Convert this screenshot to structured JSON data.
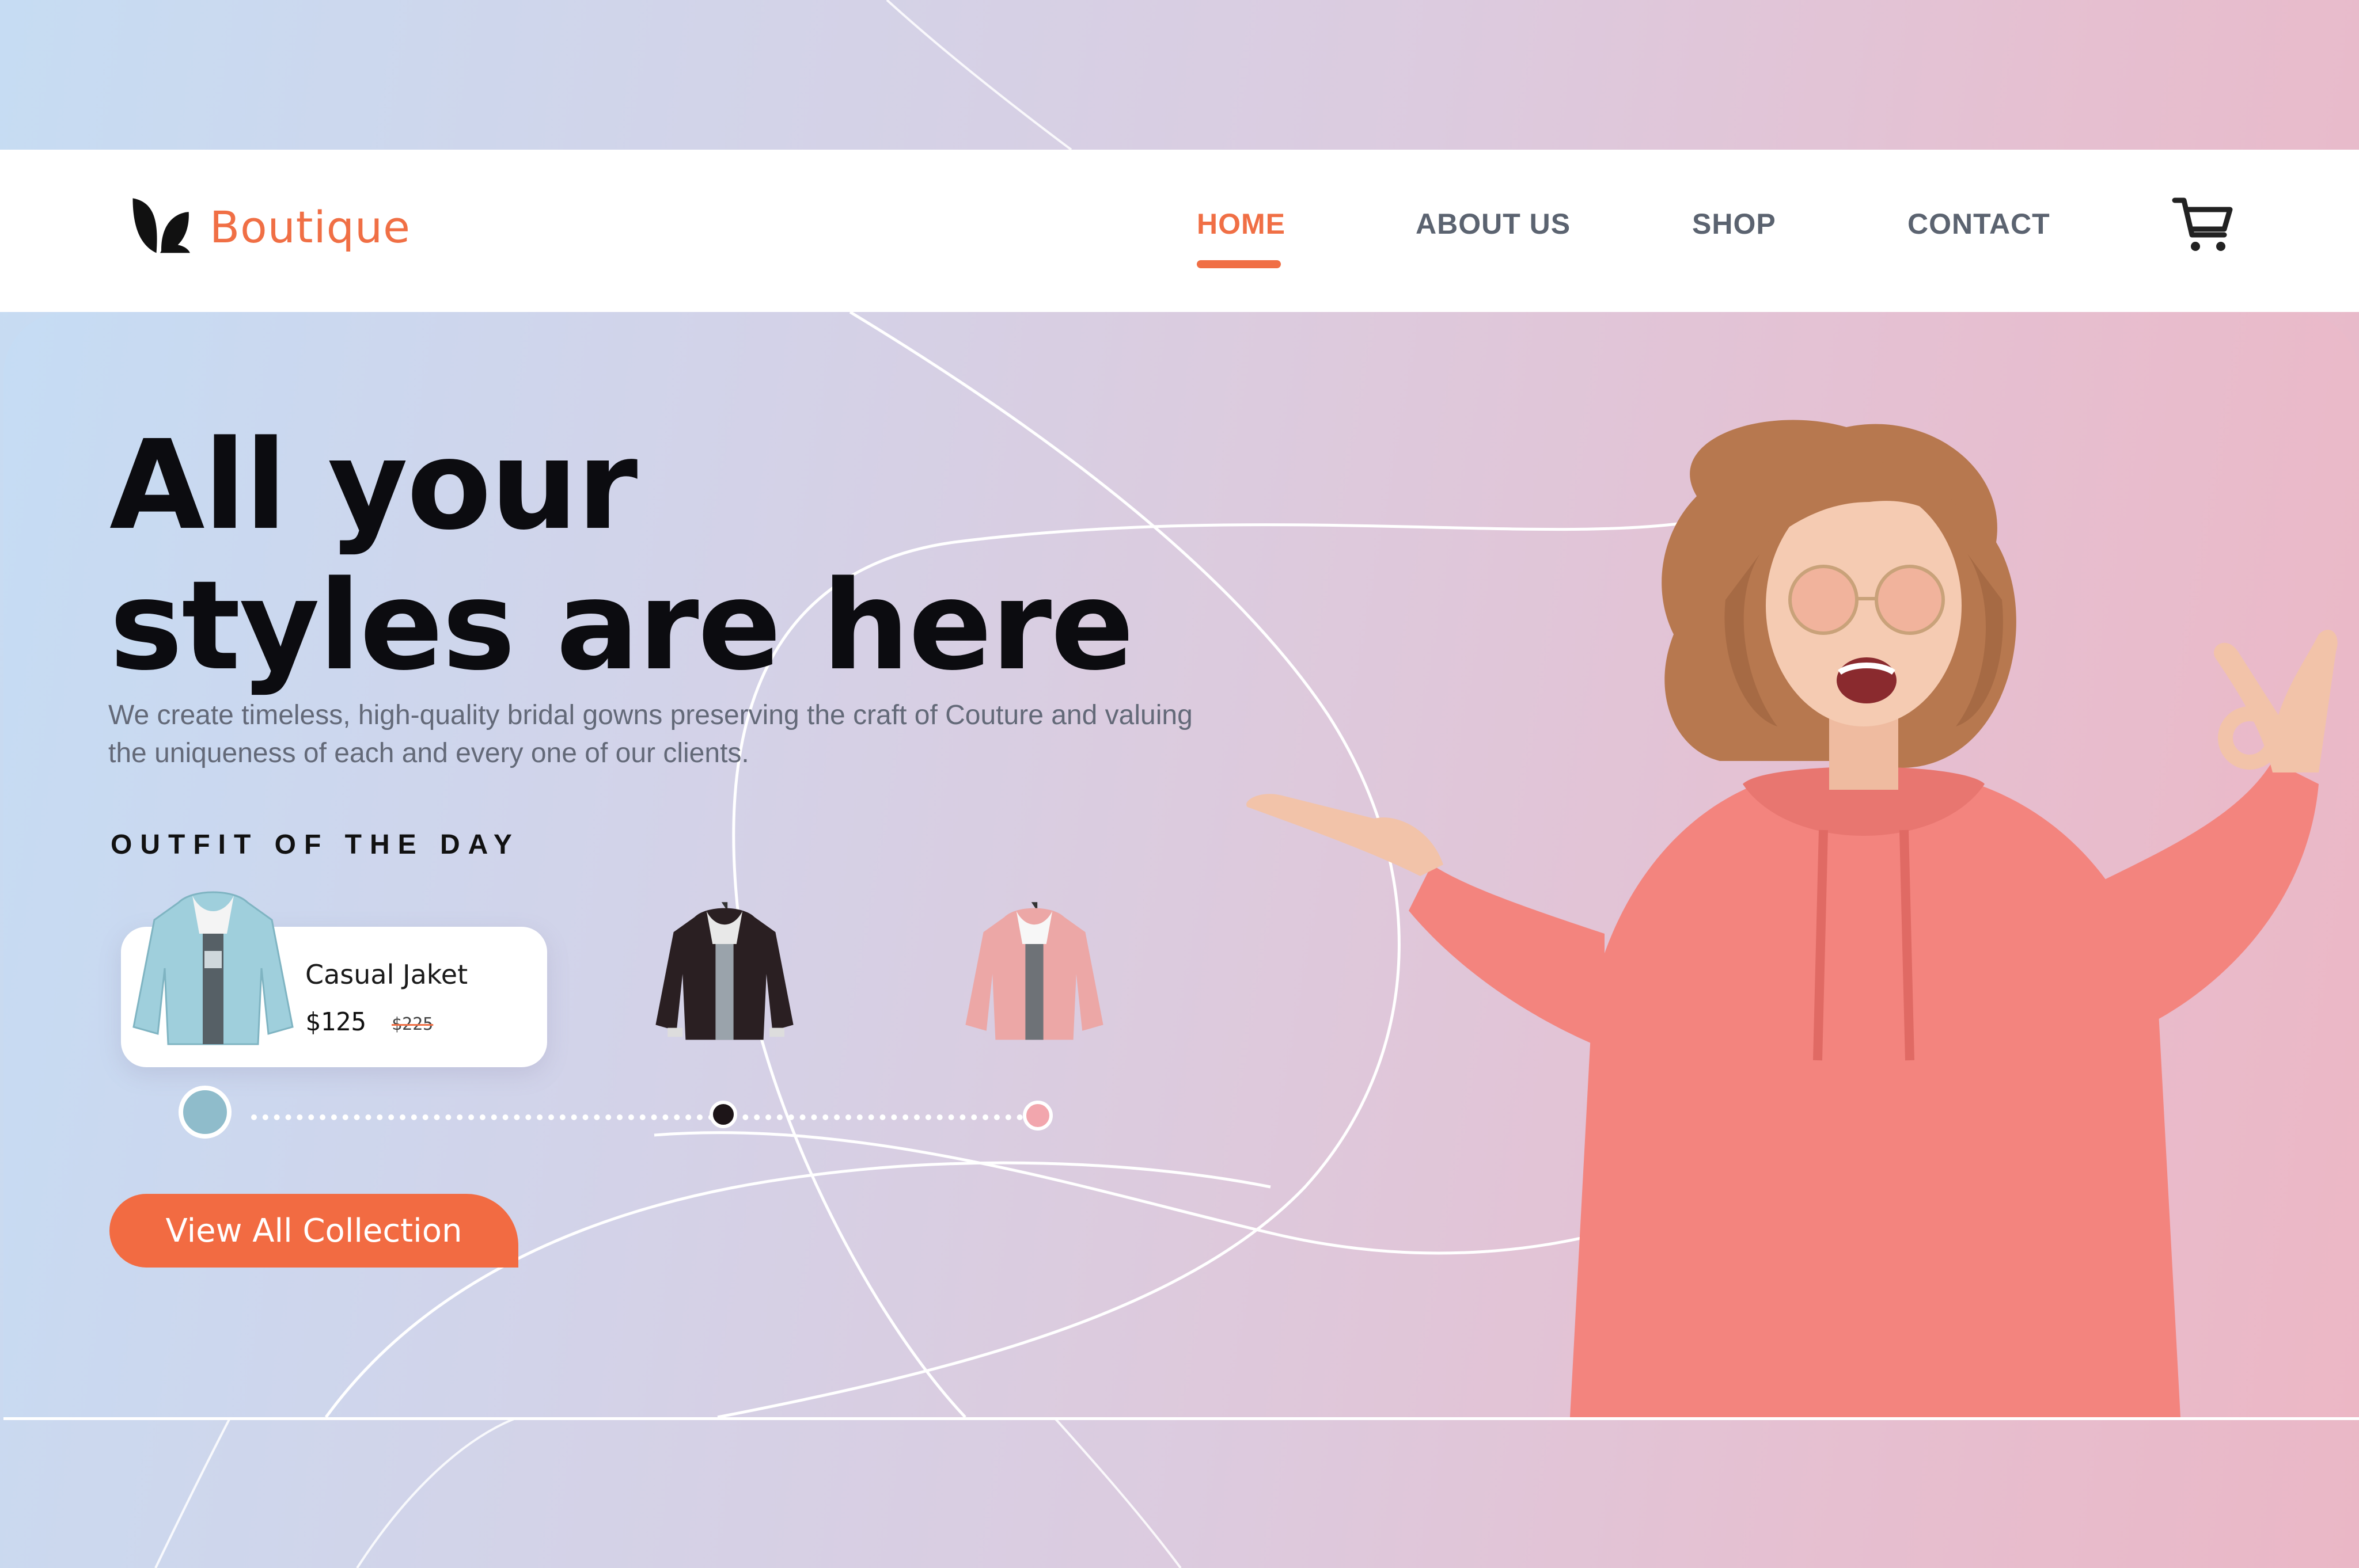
{
  "brand": {
    "name": "Boutique",
    "logo_icon": "leaf-logo-icon",
    "accent_color": "#f06f45"
  },
  "nav": {
    "items": [
      {
        "label": "HOME",
        "active": true
      },
      {
        "label": "ABOUT US",
        "active": false
      },
      {
        "label": "SHOP",
        "active": false
      },
      {
        "label": "CONTACT",
        "active": false
      }
    ],
    "cart_icon": "cart-icon"
  },
  "hero": {
    "headline_line1": "All your",
    "headline_line2": "styles are here",
    "subtext": "We create timeless, high-quality bridal gowns preserving the craft of Couture and valuing the uniqueness of each and every one of our clients.",
    "ootd_label": "OUTFIT OF THE DAY",
    "featured": {
      "name": "Casual Jaket",
      "price": "$125",
      "old_price": "$225"
    },
    "products": [
      {
        "color": "#9cc8d4",
        "selected": true
      },
      {
        "color": "#2a1f22",
        "selected": false
      },
      {
        "color": "#eca7a6",
        "selected": false
      }
    ],
    "cta_label": "View All Collection"
  }
}
